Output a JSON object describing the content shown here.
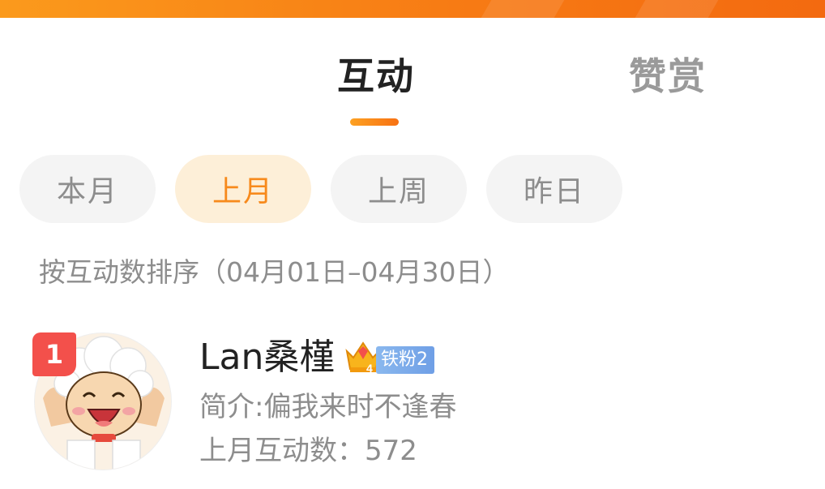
{
  "colors": {
    "accent": "#f77b14",
    "active_pill_bg": "#fdefd8",
    "active_pill_text": "#f78a1c",
    "rank_badge": "#f3504b",
    "fan_badge": "#7aaaf0"
  },
  "tabs": [
    {
      "label": "互动",
      "active": true
    },
    {
      "label": "赞赏",
      "active": false
    }
  ],
  "filters": [
    {
      "label": "本月",
      "active": false
    },
    {
      "label": "上月",
      "active": true
    },
    {
      "label": "上周",
      "active": false
    },
    {
      "label": "昨日",
      "active": false
    }
  ],
  "sort_note": "按互动数排序（04月01日–04月30日）",
  "ranking": [
    {
      "rank": "1",
      "name": "Lan桑槿",
      "fan_level": "铁粉2",
      "bio": "简介:偏我来时不逢春",
      "interaction_count": "上月互动数：572",
      "avatar_icon": "pleasant-goat-avatar"
    }
  ]
}
